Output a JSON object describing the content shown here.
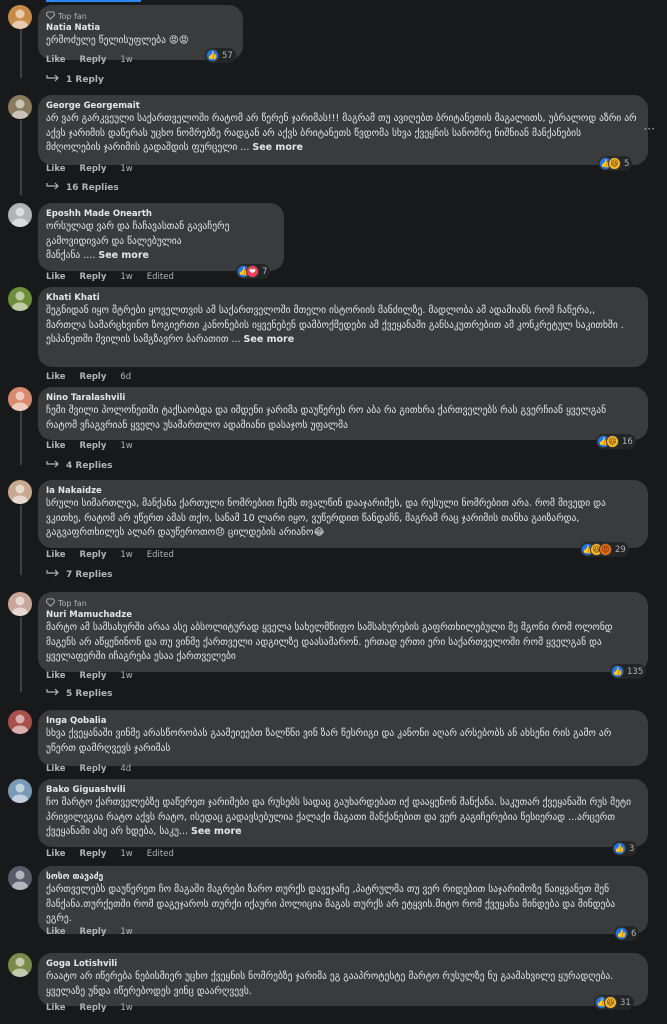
{
  "actions": {
    "like": "Like",
    "reply": "Reply",
    "edited": "Edited",
    "see_more": "See more"
  },
  "comments": [
    {
      "badge": "Top fan",
      "author": "Natia Natia",
      "text": "ერმოძულე წელისუფლება 😡😡",
      "time": "1w",
      "reactions": [
        "like"
      ],
      "count": "57",
      "replies": "1 Reply",
      "avatar_color": "#c98b4a"
    },
    {
      "author": "George Georgemait",
      "text": "არ ვარ გარკვეული საქართველოში რატომ არ წერენ ჯარიმას!!! მაგრამ თუ ავიღებთ ბრიტანეთის მაგალითს, უბრალოდ აზრი არ აქვს ჯარიმის დაწერას უცხო ნომრებზე რადგან არ აქვს ბრიტანეთს წვდომა სხვა ქვეყნის სანომრე ნიშნიან მანქანების მძღოლების ჯარიმის გადაშდის ფურცელი ...",
      "see_more": true,
      "time": "1w",
      "reactions": [
        "like",
        "haha"
      ],
      "count": "5",
      "replies": "16 Replies",
      "avatar_color": "#8a7a60"
    },
    {
      "author": "Eposhh Made Onearth",
      "text": "ორსულად ვარ და ჩაჩავასთან გავაჩერე\nგამოვიდივარ და წალებულია\nმანქანა ....",
      "see_more": true,
      "time": "1w",
      "edited": true,
      "reactions": [
        "like",
        "love"
      ],
      "count": "7",
      "avatar_color": "#b0b3b8"
    },
    {
      "author": "Khati Khati",
      "text": "შეგნიდან იყო მტრები ყოველთვის ამ საქართველოში მთელი ისტორიის მანძილზე. მადლობა ამ ადამიანს რომ ჩაწერა,, მართლა სამარცხვინო ზოგიერთი კანონების იყვენებენ დამბოქმედები ამ ქვეყანაში განსაკუთრებით ამ კონკრეტულ საკითხში . ესპანეთში შვილის სამგზავრო ბარათით ...",
      "see_more": true,
      "time": "6d",
      "avatar_color": "#6d8f3a"
    },
    {
      "author": "Nino Taralashvili",
      "text": "ჩემი შვილი პოლონეთში ტაქსაობდა და იმდენი ჯარიმა დაუწერეს რო აბა რა გითხრა ქართველებს რას გვერჩიან ყველგან რატომ ვჩაგვრიან ყველა უსამართლო ადამიანი დასაჯოს უფალმა",
      "time": "1w",
      "reactions": [
        "like",
        "haha"
      ],
      "count": "16",
      "replies": "4 Replies",
      "avatar_color": "#d98a6e"
    },
    {
      "author": "Ia Nakaidze",
      "text": "სრული სიმართლეა, მანქანა ქართული ნომრებით ჩემს თვალწინ დააჯარიმეს, და რუსული ნომრებით არა. რომ მივედი და ვკითხე, რატომ არ უწერთ ამას თქო, სანამ 10 ლარი იყო, ვუწერდით წანდაჩნ, მაგრამ რაც ჯარიმის თანხა გაიზარდა, გაგვაფრთხილეს ალარ დაუწეროთო😞 ცილდების არიანო😂",
      "time": "1w",
      "edited": true,
      "reactions": [
        "like",
        "haha",
        "angry"
      ],
      "count": "29",
      "replies": "7 Replies",
      "avatar_color": "#c7a890"
    },
    {
      "badge": "Top fan",
      "author": "Nuri Mamuchadze",
      "text": "მარტო ამ სამსახურში არაა ასე აბსოლიტურად ყველა სახელმწიფო სამსახურების გაფრთხილებული მე მგონი რომ ოლონდ მაგენს არ აწყენინონ და თუ ვინმე ქართველი ადგილზე დაასამარონ. ერთად ერთი ერი საქართველოში რომ ყველგან და ყველაფერში იჩაგრება ესაა ქართველები",
      "time": "1w",
      "reactions": [
        "like"
      ],
      "count": "135",
      "replies": "5 Replies",
      "avatar_color": "#c9a69a"
    },
    {
      "author": "Inga Qobalia",
      "text": "სხვა ქვეყანაში ვინმე არასწორობას გაამეიეებთ ზალწნი ვინ ზარ წესრიგი და კანონი აღარ არსებობს ან ახსენი რის გამო არ უწერთ დამრღვევს ჯარიმას",
      "time": "4d",
      "avatar_color": "#a8504a"
    },
    {
      "author": "Bako Giguashvili",
      "text": "ჩო მარტო ქართველებზე დაწერეთ ჯარიმები და რუსებს სადაც გაუხარდებათ იქ დააყენონ მანქანა. საკუთარ ქვეყანაში რუს მეტი პრივილეგია რატო აქვს რატო, ისედაც გადავსებულია ქალაქი მაგათი მანქანებით და ვერ გაგიჩერებია წესიერად ...არცერთ ქვეყანაში ასე არ ხდება, საკუ...",
      "see_more": true,
      "time": "1w",
      "edited": true,
      "reactions": [
        "like"
      ],
      "count": "3",
      "avatar_color": "#7a9ab8"
    },
    {
      "author": "სოსო თავაძე",
      "text": "ქართველებს დაუწერეთ ჩო მაგაში მაგრები ზარო თურქს დავეჯაჩე ,პატრულმა თუ ვერ რიდებით საჯარიმოზე წაიყვანეთ შენ მანქანა.თურქეთში რომ დაგეჯაროს თურქი იქაური პოლიცია მაგას თურქს არ ეტყვის.მიტო რომ ქვეყანა მინდება და მინდება ეგრე.",
      "time": "1w",
      "reactions": [
        "like"
      ],
      "count": "6",
      "avatar_color": "#5a5a6a"
    },
    {
      "author": "Goga Lotishvili",
      "text": "რაატო არ იწერება ნებისმიერ უცხო ქვეყნის ნომრებზე ჯარიმა ეგ გააპროტესტე მარტო რუსულზე ნუ გაამახვილე ყურადღება. ყველაზე უნდა იწერებოდეს ვინც დაარღვევს.",
      "time": "1w",
      "reactions": [
        "like",
        "haha"
      ],
      "count": "31",
      "avatar_color": "#7a8a4a"
    }
  ]
}
